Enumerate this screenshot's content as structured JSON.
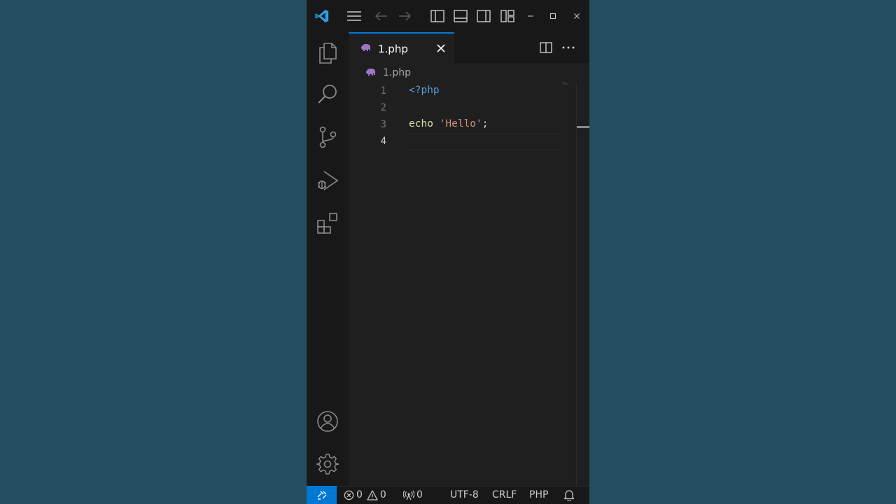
{
  "colors": {
    "background": "#234e5f",
    "accent": "#0078d4",
    "editor_bg": "#1f1f1f",
    "chrome_bg": "#181818"
  },
  "titlebar": {
    "icons": [
      "vscode-logo-icon",
      "menu-icon",
      "back-arrow-icon",
      "forward-arrow-icon",
      "toggle-primary-sidebar-icon",
      "toggle-panel-icon",
      "toggle-secondary-sidebar-icon",
      "customize-layout-icon",
      "minimize-icon",
      "maximize-icon",
      "close-window-icon"
    ]
  },
  "activitybar": {
    "items": [
      "explorer-icon",
      "search-icon",
      "source-control-icon",
      "run-debug-icon",
      "extensions-icon"
    ],
    "bottom": [
      "accounts-icon",
      "manage-gear-icon"
    ]
  },
  "tab": {
    "label": "1.php"
  },
  "breadcrumb": {
    "label": "1.php"
  },
  "editor": {
    "line_numbers": [
      "1",
      "2",
      "3",
      "4"
    ],
    "active_line": "4",
    "lines": [
      {
        "tokens": [
          "<?php"
        ]
      },
      {
        "tokens": []
      },
      {
        "tokens": [
          "echo",
          " ",
          "'Hello'",
          ";"
        ]
      },
      {
        "tokens": []
      }
    ]
  },
  "statusbar": {
    "errors": "0",
    "warnings": "0",
    "ports": "0",
    "encoding": "UTF-8",
    "eol": "CRLF",
    "language": "PHP"
  }
}
